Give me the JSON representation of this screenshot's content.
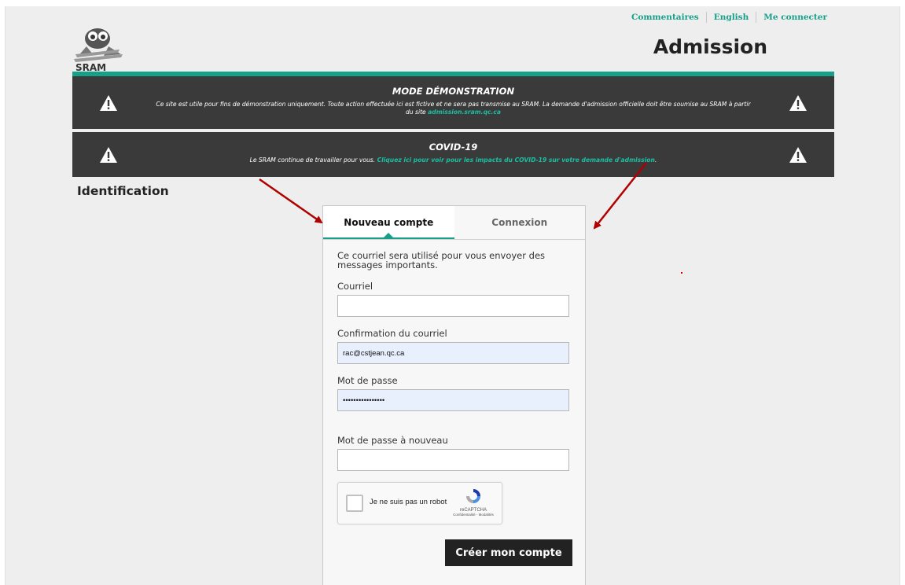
{
  "header": {
    "links": [
      "Commentaires",
      "English",
      "Me connecter"
    ],
    "logo_text": "SRAM",
    "title": "Admission"
  },
  "banners": {
    "demo": {
      "icon": "warning-icon",
      "title": "MODE DÉMONSTRATION",
      "text": "Ce site est utile pour fins de démonstration uniquement. Toute action effectuée ici est fictive et ne sera pas transmise au SRAM. La demande d'admission officielle doit être soumise au SRAM à partir du site",
      "link": "admission.sram.qc.ca"
    },
    "covid": {
      "icon": "warning-icon",
      "title": "COVID-19",
      "text": "Le SRAM continue de travailler pour vous.",
      "link": "Cliquez ici pour voir pour les impacts du COVID-19 sur votre demande d'admission",
      "suffix": "."
    }
  },
  "section": {
    "heading": "Identification"
  },
  "tabs": {
    "active": "Nouveau compte",
    "inactive": "Connexion"
  },
  "form": {
    "intro": "Ce courriel sera utilisé pour vous envoyer des messages importants.",
    "email_label": "Courriel",
    "email_value": "",
    "confirm_label": "Confirmation du courriel",
    "confirm_value": "rac@cstjean.qc.ca",
    "password_label": "Mot de passe",
    "password_value": "••••••••••••••••",
    "password2_label": "Mot de passe à nouveau",
    "password2_value": "",
    "captcha_text": "Je ne suis pas un robot",
    "captcha_brand": "reCAPTCHA",
    "captcha_terms": "Confidentialité - Modalités",
    "submit_label": "Créer mon compte"
  },
  "colors": {
    "accent": "#16a089",
    "banner": "#3a3a3a",
    "arrow": "#b00000"
  }
}
